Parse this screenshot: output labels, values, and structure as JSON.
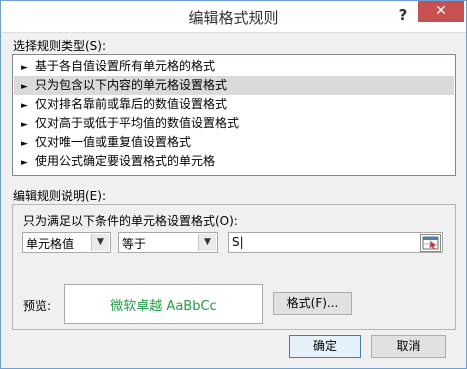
{
  "window": {
    "title": "编辑格式规则",
    "help": "?",
    "close": "✕"
  },
  "rule_type": {
    "label": "选择规则类型(S):",
    "items": [
      {
        "label": "基于各自值设置所有单元格的格式",
        "selected": false
      },
      {
        "label": "只为包含以下内容的单元格设置格式",
        "selected": true
      },
      {
        "label": "仅对排名靠前或靠后的数值设置格式",
        "selected": false
      },
      {
        "label": "仅对高于或低于平均值的数值设置格式",
        "selected": false
      },
      {
        "label": "仅对唯一值或重复值设置格式",
        "selected": false
      },
      {
        "label": "使用公式确定要设置格式的单元格",
        "selected": false
      }
    ],
    "bullet": "►"
  },
  "rule_desc": {
    "label": "编辑规则说明(E):",
    "condition_label": "只为满足以下条件的单元格设置格式(O):",
    "field_select": "单元格值",
    "operator_select": "等于",
    "value_input": "S|",
    "preview_label": "预览:",
    "preview_text": "微软卓越  AaBbCc",
    "preview_color": "#1f9d45",
    "format_button": "格式(F)..."
  },
  "footer": {
    "ok": "确定",
    "cancel": "取消"
  }
}
